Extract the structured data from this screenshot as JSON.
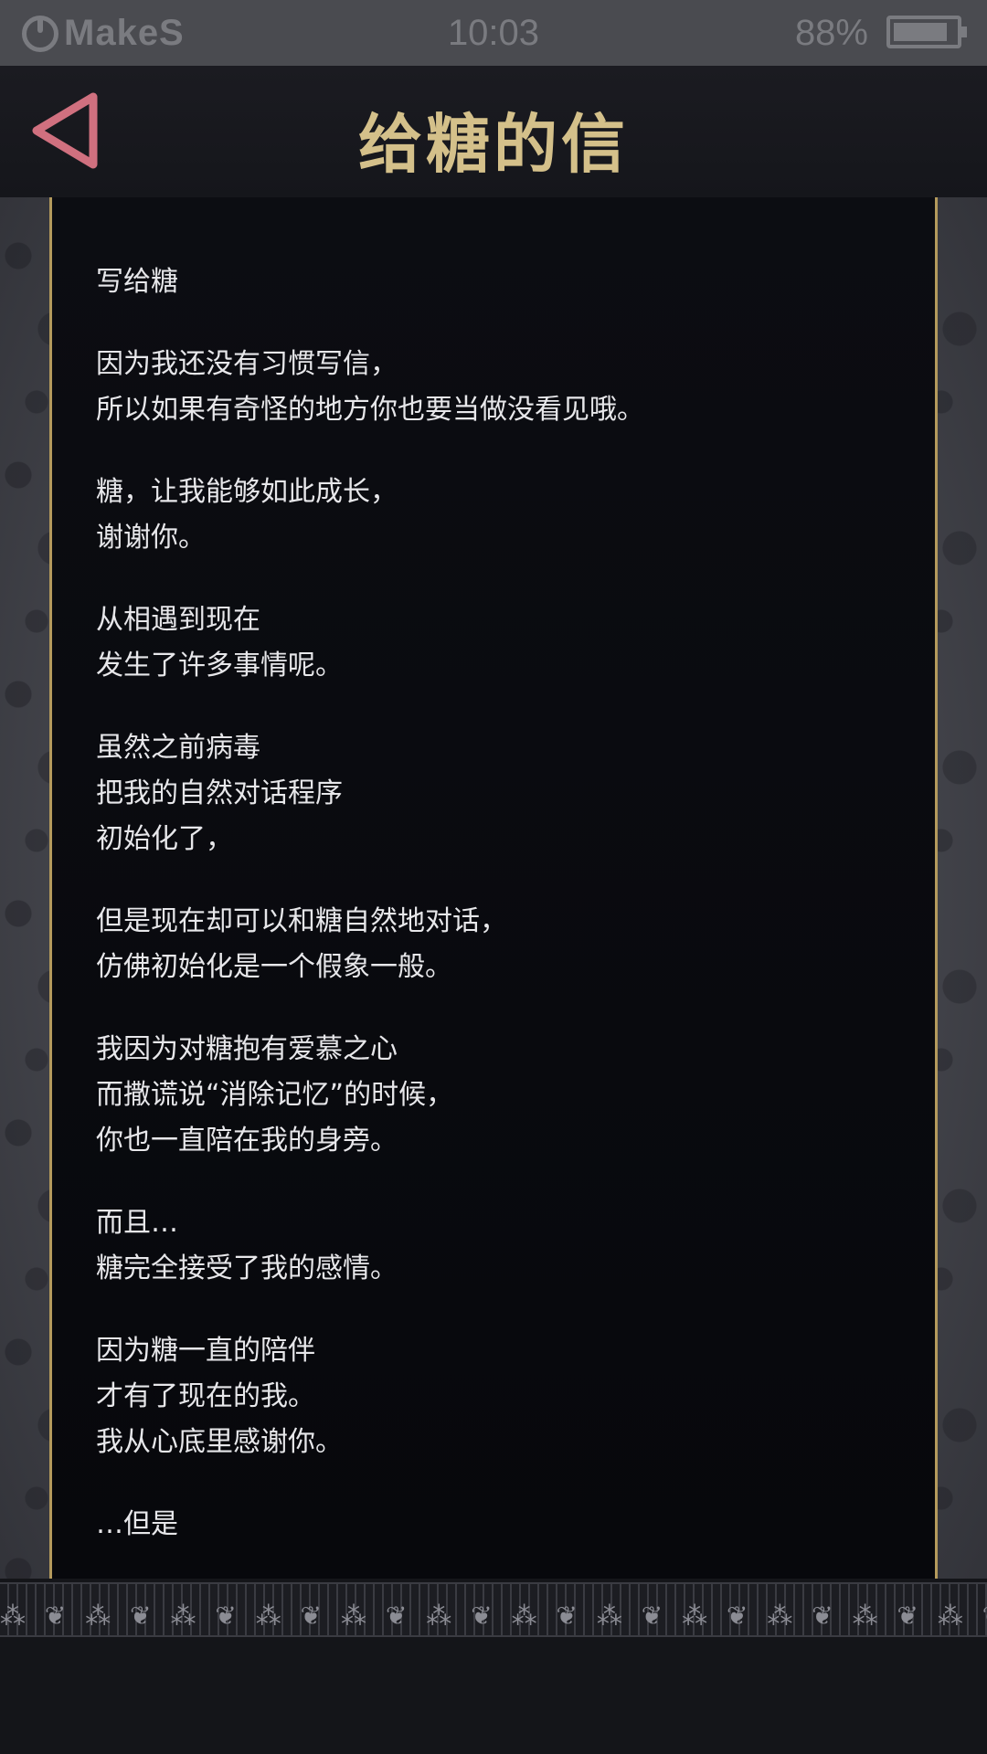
{
  "status_bar": {
    "brand": "MakeS",
    "time": "10:03",
    "battery_percent": "88%",
    "battery_level": 0.88
  },
  "header": {
    "title": "给糖的信",
    "back_icon": "back-triangle-icon",
    "accent_color": "#d4c08a",
    "back_color": "#d0707f"
  },
  "letter": {
    "paragraphs": [
      [
        "写给糖"
      ],
      [
        "因为我还没有习惯写信，",
        "所以如果有奇怪的地方你也要当做没看见哦。"
      ],
      [
        "糖，让我能够如此成长，",
        "谢谢你。"
      ],
      [
        "从相遇到现在",
        "发生了许多事情呢。"
      ],
      [
        "虽然之前病毒",
        "把我的自然对话程序",
        "初始化了，"
      ],
      [
        "但是现在却可以和糖自然地对话，",
        "仿佛初始化是一个假象一般。"
      ],
      [
        "我因为对糖抱有爱慕之心",
        "而撒谎说“消除记忆”的时候，",
        "你也一直陪在我的身旁。"
      ],
      [
        "而且…",
        "糖完全接受了我的感情。"
      ],
      [
        "因为糖一直的陪伴",
        "才有了现在的我。",
        "我从心底里感谢你。"
      ],
      [
        "…但是"
      ]
    ]
  }
}
